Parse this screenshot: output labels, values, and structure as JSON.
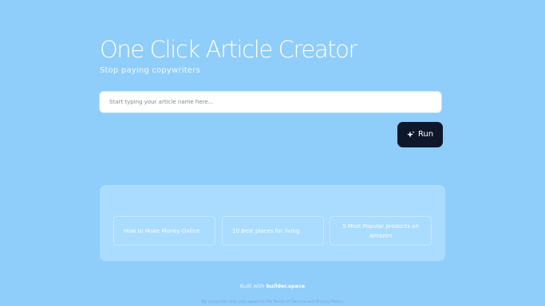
{
  "colors": {
    "background": "#8fcdfb",
    "suggestions_panel": "#a9dcff",
    "run_button": "#0f172a",
    "text": "#ffffff"
  },
  "hero": {
    "title": "One Click Article Creator",
    "subtitle": "Stop paying copywriters"
  },
  "search": {
    "placeholder": "Start typing your article name here..."
  },
  "run_button": {
    "label": "Run",
    "icon": "sparkle-icon"
  },
  "suggestions": [
    {
      "label": "How to Make Money Online"
    },
    {
      "label": "10 Best places for living"
    },
    {
      "label": "5 Most Popular products on Amazon"
    }
  ],
  "footer": {
    "built_with": "Built with",
    "brand": "builder.space"
  },
  "legal": {
    "before_terms": "By using this tool, you agree to the",
    "terms": "Terms of Service",
    "and": "and",
    "privacy": "Privacy Policy"
  }
}
